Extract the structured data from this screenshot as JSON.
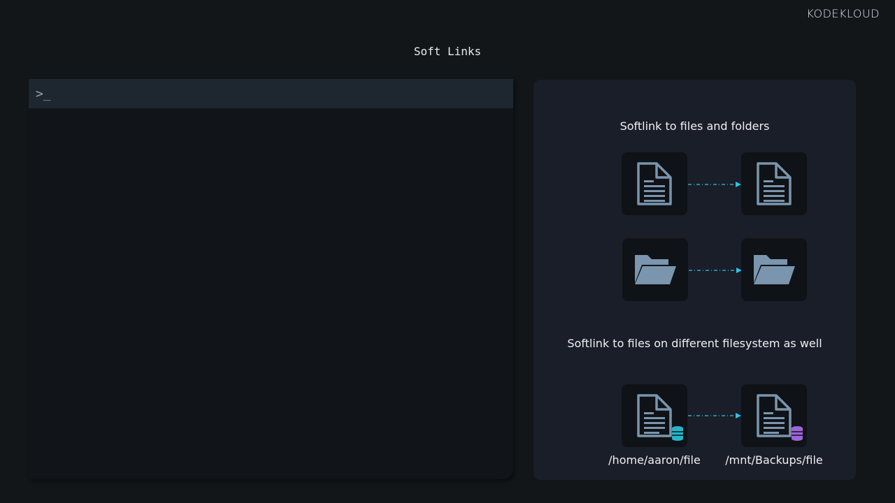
{
  "logo": "KODEKLOUD",
  "title": "Soft Links",
  "terminal": {
    "prompt": ">_"
  },
  "panel": {
    "heading_top": "Softlink to files and folders",
    "heading_bottom": "Softlink to files on different filesystem as well",
    "source_path": "/home/aaron/file",
    "target_path": "/mnt/Backups/file"
  },
  "colors": {
    "icon": "#7a95ad",
    "arrow": "#2ec3e6",
    "db_source": "#25b5c9",
    "db_target": "#a064d8"
  }
}
